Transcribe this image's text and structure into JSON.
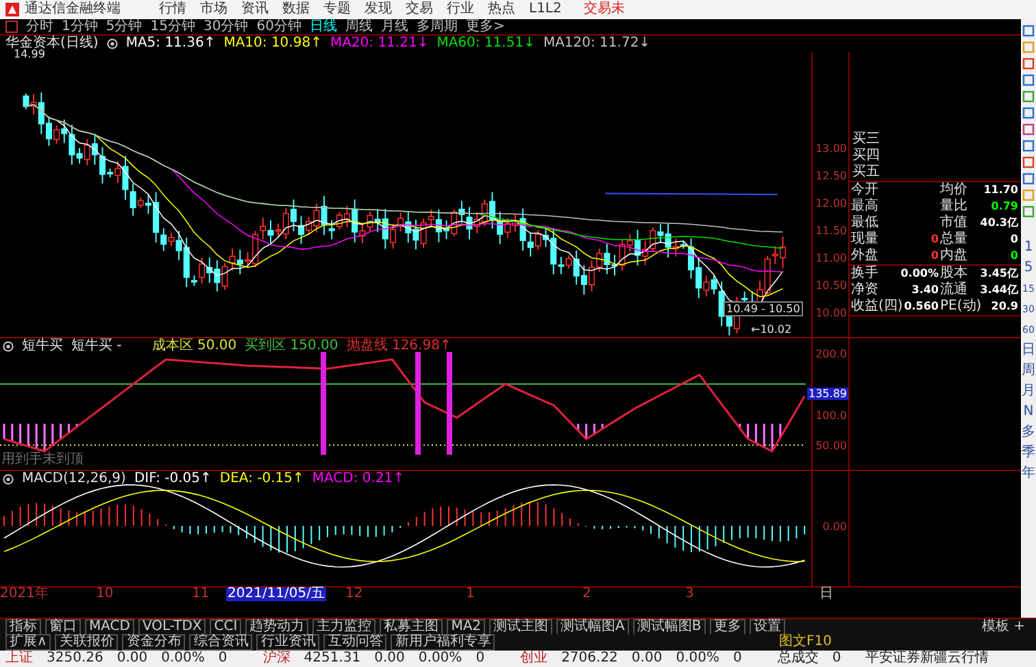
{
  "menu_bar": {
    "app_title": "通达信金融终端",
    "items": [
      "行情",
      "市场",
      "资讯",
      "数据",
      "专题",
      "发现",
      "交易",
      "行业",
      "热点",
      "L1L2"
    ],
    "trade_button": "交易未"
  },
  "period_tabs": [
    {
      "label": "分时",
      "selected": false
    },
    {
      "label": "1分钟",
      "selected": false
    },
    {
      "label": "5分钟",
      "selected": false
    },
    {
      "label": "15分钟",
      "selected": false
    },
    {
      "label": "30分钟",
      "selected": false
    },
    {
      "label": "60分钟",
      "selected": false
    },
    {
      "label": "日线",
      "selected": true
    },
    {
      "label": "周线",
      "selected": false
    },
    {
      "label": "月线",
      "selected": false
    },
    {
      "label": "多周期",
      "selected": false
    },
    {
      "label": "更多>",
      "selected": false
    }
  ],
  "price_chart": {
    "title": "华金资本(日线)",
    "ma_legend": [
      {
        "label": "MA5: 11.36↑",
        "color": "#ffffff"
      },
      {
        "label": "MA10: 10.98↑",
        "color": "#ffff00"
      },
      {
        "label": "MA20: 11.21↓",
        "color": "#ff00ff"
      },
      {
        "label": "MA60: 11.51↓",
        "color": "#00e000"
      },
      {
        "label": "MA120: 11.72↓",
        "color": "#c0c0c0"
      }
    ],
    "high_label": "14.99",
    "low_label": "←10.02",
    "price_box": "10.49 - 10.50",
    "y_ticks": [
      "13.00",
      "12.50",
      "12.00",
      "11.50",
      "11.00",
      "10.50",
      "10.00"
    ]
  },
  "quote_panel": {
    "order_book": [
      "买三",
      "买四",
      "买五"
    ],
    "sections": [
      [
        {
          "label": "今开"
        },
        {
          "label": "均价",
          "value": "11.70",
          "color": "#ffffff"
        },
        {
          "label": "最高"
        },
        {
          "label": "量比",
          "value": "0.79",
          "color": "#00ff00"
        },
        {
          "label": "最低"
        },
        {
          "label": "市值",
          "value": "40.3亿",
          "color": "#ffffff"
        },
        {
          "label": "现量",
          "value": "0",
          "color": "#ff3030"
        },
        {
          "label": "总量",
          "value": "0",
          "color": "#ffffff"
        },
        {
          "label": "外盘",
          "value": "0",
          "color": "#ff3030"
        },
        {
          "label": "内盘",
          "value": "0",
          "color": "#00ff00"
        }
      ],
      [
        {
          "label": "换手",
          "value": "0.00%",
          "color": "#ffffff"
        },
        {
          "label": "股本",
          "value": "3.45亿",
          "color": "#ffffff"
        },
        {
          "label": "净资",
          "value": "3.40",
          "color": "#ffffff"
        },
        {
          "label": "流通",
          "value": "3.44亿",
          "color": "#ffffff"
        },
        {
          "label": "收益(四)",
          "value": "0.560",
          "color": "#ffffff"
        },
        {
          "label": "PE(动)",
          "value": "20.9",
          "color": "#ffffff"
        }
      ]
    ]
  },
  "side_toolbar": {
    "period_shortcuts": [
      "1",
      "5",
      "15",
      "30",
      "60",
      "日",
      "周",
      "月",
      "N",
      "多",
      "季",
      "年"
    ]
  },
  "indicator": {
    "title": "短牛买",
    "formula": "短牛买 -",
    "values": [
      {
        "label": "成本区 50.00",
        "color": "#e0e040"
      },
      {
        "label": "买到区 150.00",
        "color": "#40c040"
      },
      {
        "label": "抛盘线 126.98↑",
        "color": "#e03030"
      }
    ],
    "y_ticks": [
      "200.0",
      "100.0",
      "50.00"
    ],
    "current_value": "135.89",
    "note": "用到手未到顶"
  },
  "macd": {
    "values": [
      {
        "label": "MACD(12,26,9)",
        "color": "#e0e0e0"
      },
      {
        "label": "DIF: -0.05↑",
        "color": "#ffffff"
      },
      {
        "label": "DEA: -0.15↑",
        "color": "#ffff00"
      },
      {
        "label": "MACD: 0.21↑",
        "color": "#ff00ff"
      }
    ],
    "y_ticks": [
      "0.00"
    ]
  },
  "date_axis": {
    "labels": [
      "2021年",
      "10",
      "11",
      "12",
      "1",
      "2",
      "3"
    ],
    "cursor_date": "2021/11/05/五",
    "corner": "日"
  },
  "indicator_tabs": {
    "items": [
      "指标",
      "窗口",
      "MACD",
      "VOL-TDX",
      "CCI",
      "趋势动力",
      "主力监控",
      "私募主图",
      "MA2",
      "测试主图",
      "测试幅图A",
      "测试幅图B",
      "更多",
      "设置"
    ],
    "template": "模板",
    "add": "+"
  },
  "info_tabs": {
    "items": [
      "扩展∧",
      "关联报价",
      "资金分布",
      "综合资讯",
      "行业资讯",
      "互动问答",
      "新用户福利专享"
    ],
    "f10": "图文F10"
  },
  "status_bar": {
    "indices": [
      {
        "name": "上证",
        "value": "3250.26",
        "change": "0.00",
        "percent": "0.00%",
        "volume": "0"
      },
      {
        "name": "沪深",
        "value": "4251.31",
        "change": "0.00",
        "percent": "0.00%",
        "volume": "0"
      },
      {
        "name": "创业",
        "value": "2706.22",
        "change": "0.00",
        "percent": "0.00%",
        "volume": "0"
      }
    ],
    "total_label": "总成交",
    "total_value": "0",
    "broker": "平安证券新疆云行情"
  }
}
